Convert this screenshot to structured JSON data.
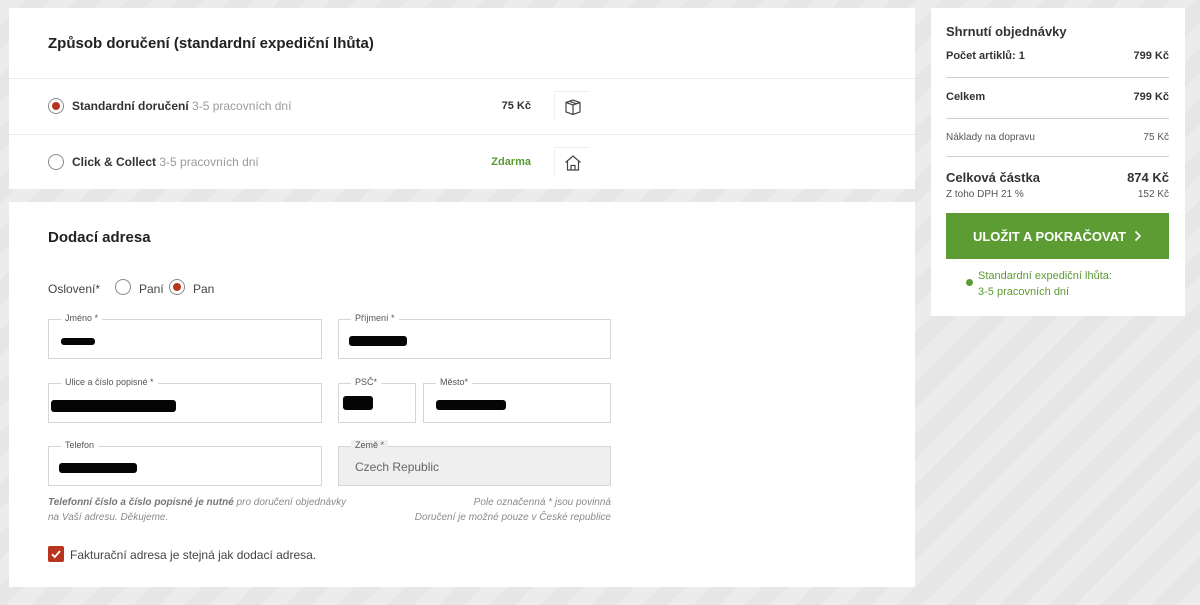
{
  "delivery": {
    "title": "Způsob doručení (standardní expediční lhůta)",
    "options": [
      {
        "name": "Standardní doručení",
        "time": "3-5 pracovních dní",
        "price": "75 Kč",
        "selected": true,
        "icon": "package-icon"
      },
      {
        "name": "Click & Collect",
        "time": "3-5 pracovních dní",
        "price": "Zdarma",
        "selected": false,
        "icon": "store-icon"
      }
    ]
  },
  "address": {
    "title": "Dodací adresa",
    "salutation_label": "Oslovení*",
    "salutation_options": [
      "Paní",
      "Pan"
    ],
    "salutation_selected": "Pan",
    "fields": {
      "first_name_label": "Jméno *",
      "last_name_label": "Příjmení *",
      "street_label": "Ulice a číslo popisné *",
      "zip_label": "PSČ*",
      "city_label": "Město*",
      "phone_label": "Telefon",
      "country_label": "Země *",
      "country_value": "Czech Republic"
    },
    "note_left_bold": "Telefonní číslo a číslo popisné je nutné",
    "note_left_rest": " pro doručení objednávky na Vaší adresu. Děkujeme.",
    "note_right_line1": "Pole označenná * jsou povinná",
    "note_right_line2": "Doručení je možné pouze v České republice",
    "billing_same_label": "Fakturační adresa je stejná jak dodací adresa.",
    "billing_same_checked": true
  },
  "summary": {
    "title": "Shrnutí objednávky",
    "items_label": "Počet artiklů: 1",
    "items_value": "799 Kč",
    "subtotal_label": "Celkem",
    "subtotal_value": "799 Kč",
    "shipping_label": "Náklady na dopravu",
    "shipping_value": "75 Kč",
    "total_label": "Celková částka",
    "total_value": "874 Kč",
    "vat_label": "Z toho DPH 21 %",
    "vat_value": "152 Kč",
    "cta_label": "ULOŽIT A POKRAČOVAT",
    "ship_info_line1": "Standardní expediční lhůta:",
    "ship_info_line2": "3-5 pracovních dní"
  },
  "colors": {
    "accent_green": "#5d9b33",
    "radio_red": "#b8341f"
  }
}
